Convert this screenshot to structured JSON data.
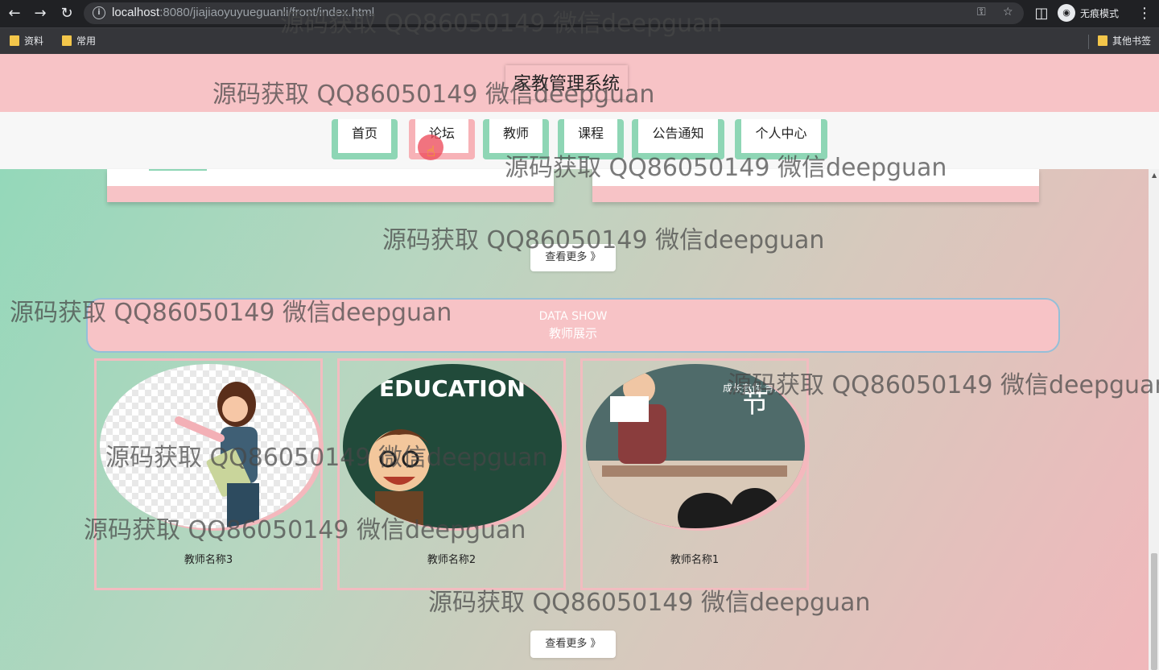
{
  "browser": {
    "url_host": "localhost",
    "url_path": ":8080/jiajiaoyuyueguanli/front/index.html",
    "incognito_label": "无痕模式",
    "bookmarks": [
      "资料",
      "常用"
    ],
    "other_bookmarks": "其他书签"
  },
  "site": {
    "title": "家教管理系统",
    "nav": [
      "首页",
      "论坛",
      "教师",
      "课程",
      "公告通知",
      "个人中心"
    ],
    "active_nav": "论坛"
  },
  "forum_section": {
    "more_label": "查看更多 》"
  },
  "teacher_section": {
    "title_en": "DATA SHOW",
    "title_cn": "教师展示",
    "teachers": [
      {
        "name": "教师名称3"
      },
      {
        "name": "教师名称2",
        "image_text": "EDUCATION"
      },
      {
        "name": "教师名称1",
        "image_text": "节",
        "image_subtext": "成长有你 青葱岁月"
      }
    ],
    "more_label": "查看更多 》"
  },
  "watermark": "源码获取 QQ86050149 微信deepguan",
  "colors": {
    "header_pink": "#f7c3c6",
    "nav_green": "#8ed6b5",
    "nav_active_pink": "#f7b2b7"
  }
}
